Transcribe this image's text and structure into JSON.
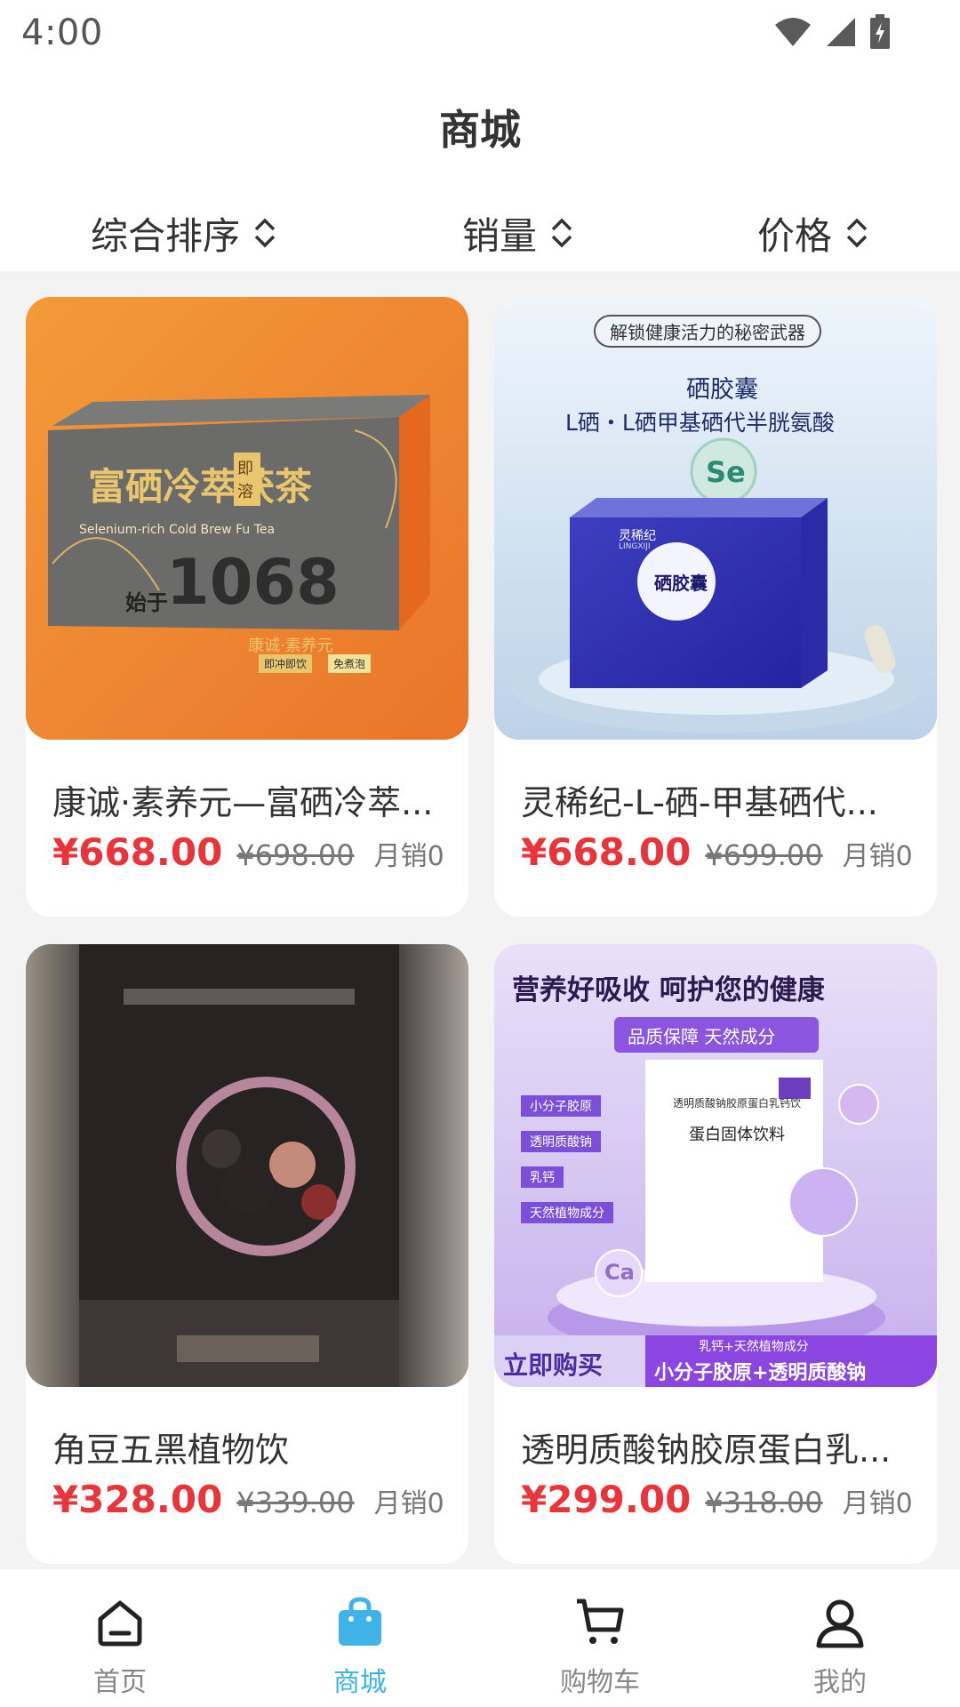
{
  "status_bar": {
    "time": "4:00",
    "icons": [
      "wifi-icon",
      "signal-icon",
      "battery-charging-icon"
    ]
  },
  "header": {
    "title": "商城"
  },
  "sort_bar": {
    "items": [
      {
        "label": "综合排序",
        "icon": "sort-updown-icon"
      },
      {
        "label": "销量",
        "icon": "sort-updown-icon"
      },
      {
        "label": "价格",
        "icon": "sort-updown-icon"
      }
    ]
  },
  "products": [
    {
      "name": "康诚·素养元—富硒冷萃...",
      "price": "¥668.00",
      "original_price": "¥698.00",
      "sales": "月销0",
      "image": {
        "background": "#f08a2c",
        "box_title": "富硒冷萃茯茶",
        "box_badge": "即溶",
        "box_english": "Selenium-rich Cold Brew Fu Tea",
        "box_number": "1068",
        "box_prefix": "始于",
        "box_brand": "康诚·素养元",
        "box_tag1": "即冲即饮",
        "box_tag2": "免煮泡"
      }
    },
    {
      "name": "灵稀纪-L-硒-甲基硒代...",
      "price": "¥668.00",
      "original_price": "¥699.00",
      "sales": "月销0",
      "image": {
        "background": "#d9e8f5",
        "banner": "解锁健康活力的秘密武器",
        "headline1": "硒胶囊",
        "headline2": "L硒・L硒甲基硒代半胱氨酸",
        "element": "Se",
        "box_brand": "灵稀纪",
        "box_brand_en": "LINGXIJI",
        "box_title": "硒胶囊"
      }
    },
    {
      "name": "角豆五黑植物饮",
      "price": "¥328.00",
      "original_price": "¥339.00",
      "sales": "月销0",
      "image": {
        "background": "#3a3633"
      }
    },
    {
      "name": "透明质酸钠胶原蛋白乳...",
      "price": "¥299.00",
      "original_price": "¥318.00",
      "sales": "月销0",
      "image": {
        "background": "#d8c8f0",
        "headline": "营养好吸收 呵护您的健康",
        "ribbon": "品质保障 天然成分",
        "tags": [
          "小分子胶原",
          "透明质酸钠",
          "乳钙",
          "天然植物成分"
        ],
        "box_title": "透明质酸钠胶原蛋白乳钙饮",
        "box_subtitle": "蛋白固体饮料",
        "element": "Ca",
        "buy_now": "立即购买",
        "footer_small": "乳钙+天然植物成分",
        "footer_big": "小分子胶原+透明质酸钠"
      }
    }
  ],
  "bottom_nav": {
    "items": [
      {
        "label": "首页",
        "icon": "home-icon",
        "active": false
      },
      {
        "label": "商城",
        "icon": "shopping-bag-icon",
        "active": true
      },
      {
        "label": "购物车",
        "icon": "cart-icon",
        "active": false
      },
      {
        "label": "我的",
        "icon": "user-icon",
        "active": false
      }
    ]
  },
  "colors": {
    "price": "#e8343a",
    "active_tab": "#3fb3e8",
    "inactive_tab": "#888888",
    "grid_background": "#f3f3f4"
  }
}
